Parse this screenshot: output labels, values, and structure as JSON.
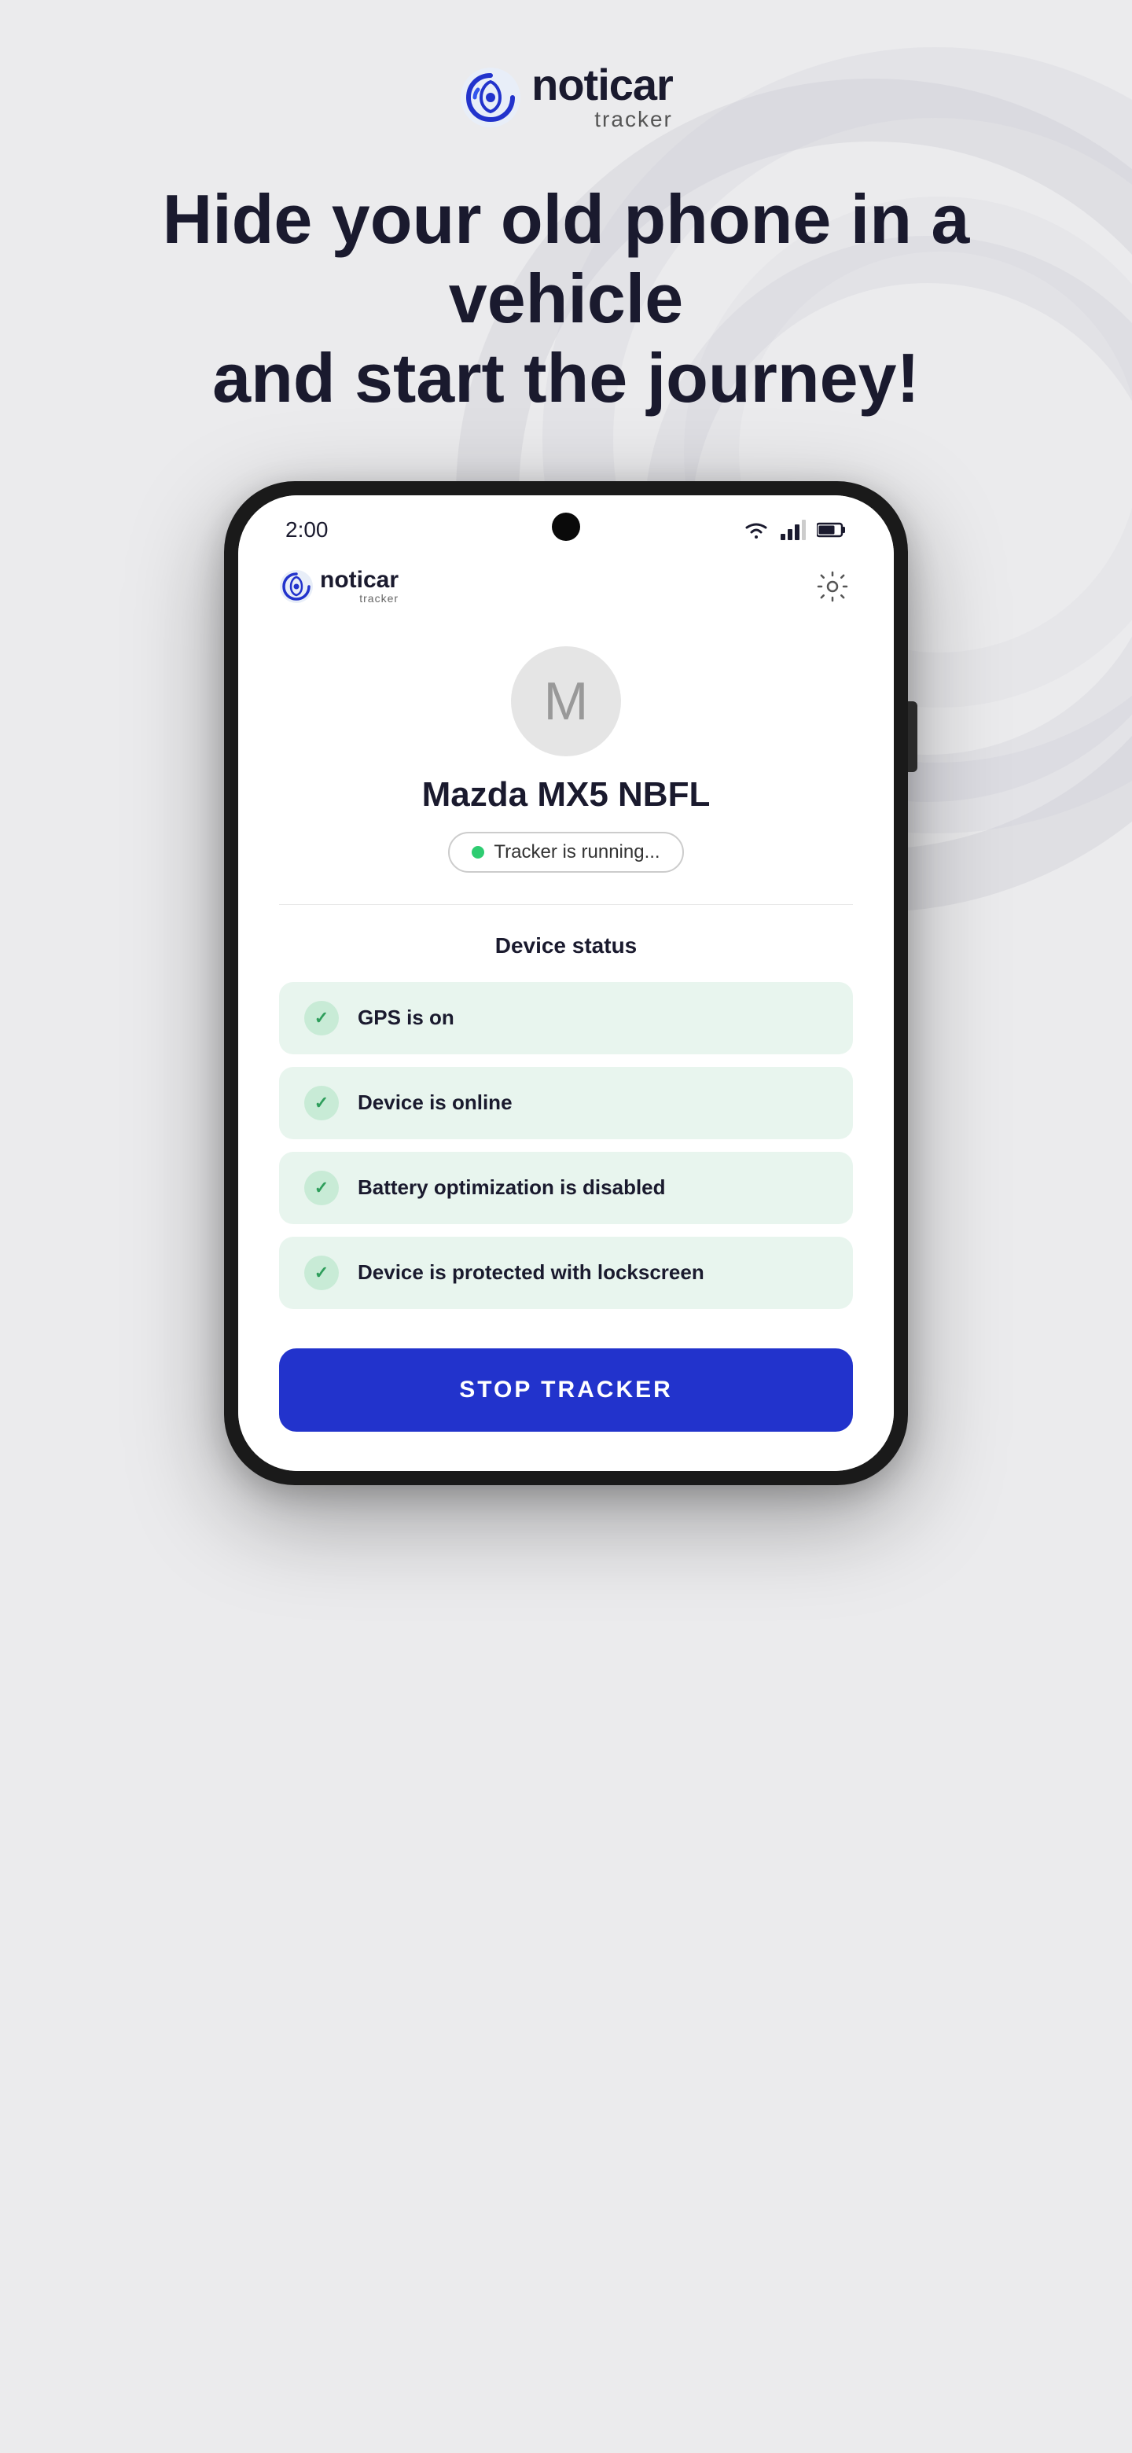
{
  "background": {
    "color": "#ebebed"
  },
  "logo": {
    "noticar": "noticar",
    "tracker": "tracker",
    "icon_alt": "noticar logo icon"
  },
  "headline": {
    "line1": "Hide your old phone in a vehicle",
    "line2": "and start the journey!",
    "full": "Hide your old phone in a vehicle and start the journey!"
  },
  "phone": {
    "status_bar": {
      "time": "2:00",
      "wifi": "wifi-icon",
      "signal": "signal-icon",
      "battery": "battery-icon"
    },
    "app_header": {
      "logo_noticar": "noticar",
      "logo_tracker": "tracker",
      "settings_icon": "gear-icon"
    },
    "vehicle": {
      "avatar_letter": "M",
      "name": "Mazda MX5 NBFL",
      "tracker_status": "Tracker is running...",
      "status_dot_color": "#2ecc71"
    },
    "device_status": {
      "title": "Device status",
      "items": [
        {
          "id": "gps",
          "text": "GPS is on",
          "checked": true
        },
        {
          "id": "online",
          "text": "Device is online",
          "checked": true
        },
        {
          "id": "battery",
          "text": "Battery optimization is disabled",
          "checked": true
        },
        {
          "id": "lockscreen",
          "text": "Device is protected with lockscreen",
          "checked": true
        }
      ]
    },
    "stop_button": {
      "label": "STOP TRACKER"
    }
  },
  "colors": {
    "accent_blue": "#2233cc",
    "green_check": "#2e9e5b",
    "green_bg": "#e8f5ee",
    "green_circle": "#c8ebd6",
    "dark_text": "#1a1a2e"
  }
}
